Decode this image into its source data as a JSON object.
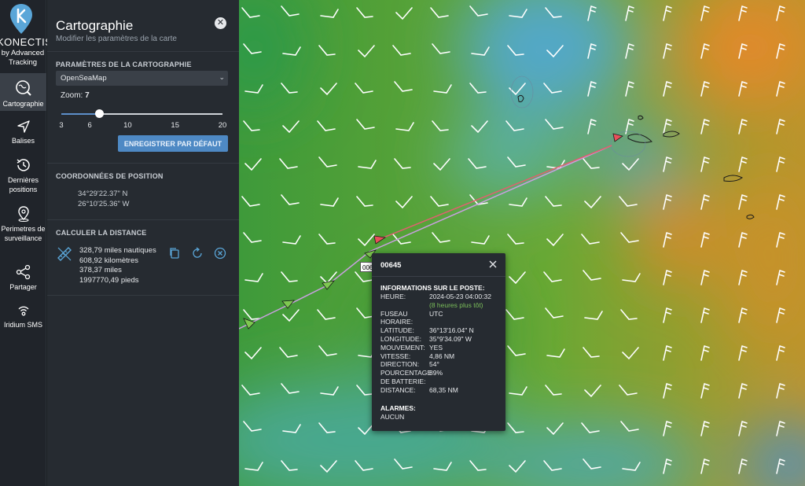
{
  "app": {
    "brand": "KONECTIS",
    "brand_sub": "by Advanced Tracking"
  },
  "nav": {
    "items": [
      {
        "label": "Cartographie",
        "icon": "map-search-icon",
        "active": true
      },
      {
        "label": "Balises",
        "icon": "navigation-arrow-icon",
        "active": false
      },
      {
        "label": "Dernières positions",
        "icon": "history-icon",
        "active": false
      },
      {
        "label": "Perimetres de surveillance",
        "icon": "location-pin-icon",
        "active": false
      },
      {
        "label": "Partager",
        "icon": "share-icon",
        "active": false
      },
      {
        "label": "Iridium SMS",
        "icon": "antenna-icon",
        "active": false
      }
    ]
  },
  "panel": {
    "title": "Cartographie",
    "subtitle": "Modifier les paramètres de la carte",
    "settings": {
      "title": "PARAMÈTRES DE LA CARTOGRAPHIE",
      "map_layer": "OpenSeaMap",
      "zoom_label": "Zoom:",
      "zoom_value": "7",
      "zoom_min": 3,
      "zoom_max": 20,
      "zoom_current": 7,
      "ticks": [
        "3",
        "6",
        "10",
        "15",
        "20"
      ],
      "save_button": "ENREGISTRER PAR DÉFAUT"
    },
    "position": {
      "title": "COORDONNÉES DE POSITION",
      "lat": "34°29'22.37\" N",
      "lon": "26°10'25.36\" W"
    },
    "distance": {
      "title": "CALCULER LA DISTANCE",
      "nautical": "328,79 miles nautiques",
      "km": "608,92 kilomètres",
      "miles": "378,37 miles",
      "feet": "1997770,49 pieds"
    }
  },
  "popup": {
    "title": "00645",
    "info_title": "INFORMATIONS SUR LE POSTE:",
    "rows": [
      {
        "key": "HEURE:",
        "value": "2024-05-23 04:00:32"
      },
      {
        "key": "",
        "value": "(8 heures plus tôt)"
      },
      {
        "key": "FUSEAU",
        "value": "UTC"
      },
      {
        "key": "HORAIRE:",
        "value": ""
      },
      {
        "key": "LATITUDE:",
        "value": "36°13'16.04\" N"
      },
      {
        "key": "LONGITUDE:",
        "value": "35°9'34.09\" W"
      },
      {
        "key": "MOUVEMENT:",
        "value": "YES"
      },
      {
        "key": "VITESSE:",
        "value": "4,86 NM"
      },
      {
        "key": "DIRECTION:",
        "value": "54°"
      },
      {
        "key": "POURCENTAGE",
        "value": "89%"
      },
      {
        "key": "DE BATTERIE:",
        "value": ""
      },
      {
        "key": "DISTANCE:",
        "value": "68,35 NM"
      }
    ],
    "alarms_title": "ALARMES:",
    "alarms_value": "AUCUN"
  },
  "map": {
    "track_label": "00645",
    "colors": {
      "track": "#e06070",
      "track_old": "#c9a0e0",
      "marker": "#7ec850",
      "end_marker": "#e8505a"
    }
  }
}
